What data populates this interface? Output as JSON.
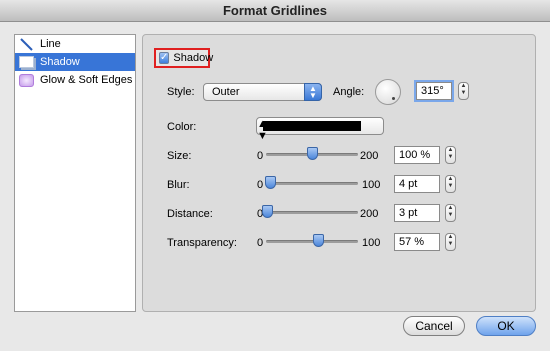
{
  "window": {
    "title": "Format Gridlines"
  },
  "sidebar": {
    "items": [
      {
        "label": "Line",
        "icon": "line-icon"
      },
      {
        "label": "Shadow",
        "icon": "shadow-icon",
        "selected": true
      },
      {
        "label": "Glow & Soft Edges",
        "icon": "glow-icon"
      }
    ]
  },
  "shadow": {
    "checkbox_label": "Shadow",
    "checked": true,
    "style_label": "Style:",
    "style_value": "Outer",
    "angle_label": "Angle:",
    "angle_value": "315°",
    "color_label": "Color:",
    "color_value": "#000000",
    "size": {
      "label": "Size:",
      "min": "0",
      "max": "200",
      "value": "100 %",
      "position": 0.5
    },
    "blur": {
      "label": "Blur:",
      "min": "0",
      "max": "100",
      "value": "4 pt",
      "position": 0.04
    },
    "distance": {
      "label": "Distance:",
      "min": "0",
      "max": "200",
      "value": "3 pt",
      "position": 0.015
    },
    "transparency": {
      "label": "Transparency:",
      "min": "0",
      "max": "100",
      "value": "57 %",
      "position": 0.57
    }
  },
  "buttons": {
    "cancel": "Cancel",
    "ok": "OK"
  },
  "colors": {
    "accent": "#3875d7",
    "highlight_border": "#e02020"
  }
}
